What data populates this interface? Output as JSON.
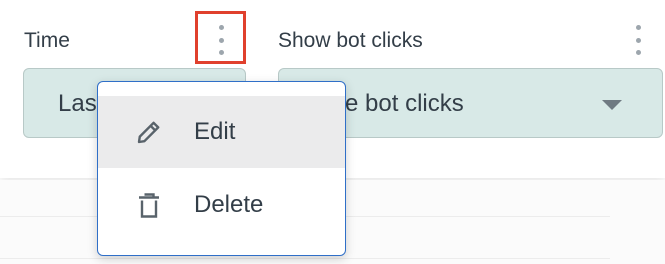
{
  "filters": [
    {
      "label": "Time",
      "selected_value": "Last 30 days"
    },
    {
      "label": "Show bot clicks",
      "selected_value": "Exclude bot clicks"
    }
  ],
  "options_menu": {
    "items": [
      {
        "label": "Edit",
        "icon": "pencil-icon",
        "highlighted": true
      },
      {
        "label": "Delete",
        "icon": "trash-icon",
        "highlighted": false
      }
    ]
  },
  "colors": {
    "select_background": "#d8e9e7",
    "menu_border": "#2f6fc8",
    "focus_outline": "#e0402d",
    "text": "#333e48"
  }
}
